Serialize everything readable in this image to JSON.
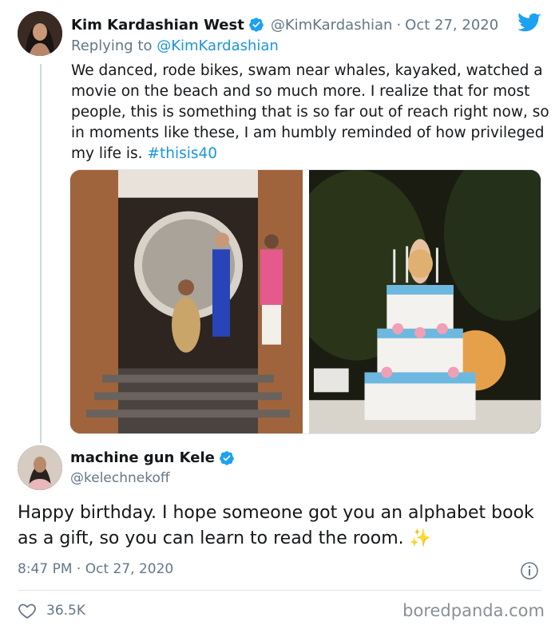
{
  "tweet1": {
    "author_name": "Kim Kardashian West",
    "handle": "@KimKardashian",
    "separator": "·",
    "date": "Oct 27, 2020",
    "replying_prefix": "Replying to",
    "replying_to": "@KimKardashian",
    "body": "We danced, rode bikes, swam near whales, kayaked, watched a movie on the beach and so much more. I realize that for most people, this is something that is so far out of reach right now, so in moments like these, I am humbly reminded of how privileged my life is.",
    "hashtag": "#thisis40"
  },
  "tweet2": {
    "author_name": "machine gun Kele",
    "handle": "@kelechnekoff",
    "body": "Happy birthday. I hope someone got you an alphabet book as a gift, so you can learn to read the room.",
    "emoji": "✨",
    "time": "8:47 PM",
    "separator": "·",
    "date": "Oct 27, 2020",
    "likes": "36.5K"
  },
  "watermark": "boredpanda.com",
  "colors": {
    "link": "#1b95e0",
    "text": "#14171a",
    "secondary": "#657786",
    "verified": "#1da1f2",
    "divider": "#e1e8ed"
  },
  "icons": [
    "verified-badge-icon",
    "twitter-bird-icon",
    "info-icon",
    "heart-icon"
  ]
}
